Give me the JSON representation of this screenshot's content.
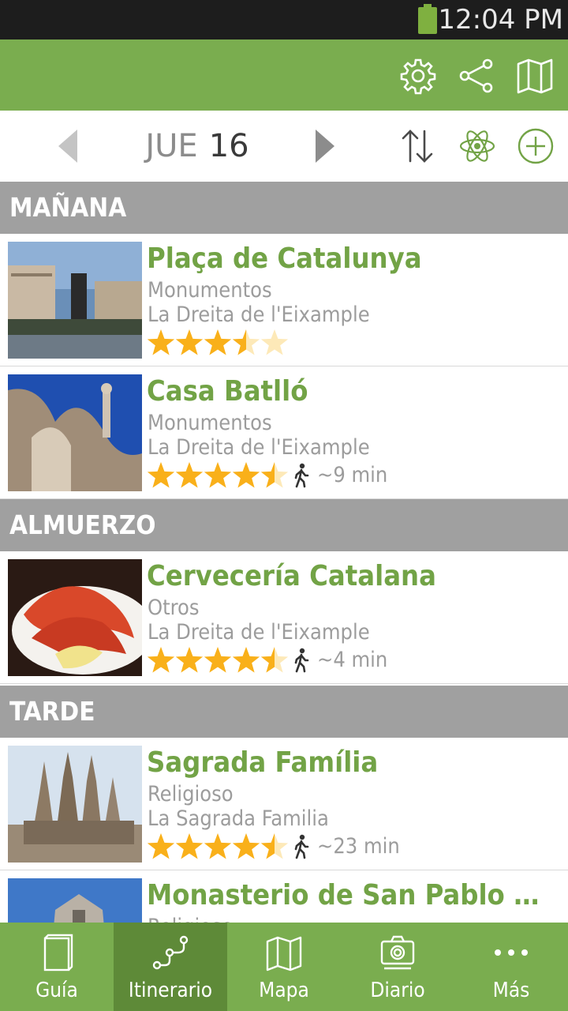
{
  "status_bar": {
    "time": "12:04 PM",
    "battery_color": "#7fb040"
  },
  "action_bar": {
    "color": "#7aad4f",
    "icons": [
      "gear-icon",
      "share-icon",
      "map-icon"
    ]
  },
  "date_nav": {
    "weekday": "JUE",
    "day": "16",
    "tools": [
      "sort-icon",
      "atom-icon",
      "add-icon"
    ]
  },
  "sections": [
    {
      "title": "MAÑANA",
      "items": [
        {
          "title": "Plaça de Catalunya",
          "category": "Monumentos",
          "area": "La Dreita de l'Eixample",
          "rating": 3.5,
          "walk_time": ""
        },
        {
          "title": "Casa Batlló",
          "category": "Monumentos",
          "area": "La Dreita de l'Eixample",
          "rating": 4.5,
          "walk_time": "~9 min"
        }
      ]
    },
    {
      "title": "ALMUERZO",
      "items": [
        {
          "title": "Cervecería Catalana",
          "category": "Otros",
          "area": "La Dreita de l'Eixample",
          "rating": 4.5,
          "walk_time": "~4 min"
        }
      ]
    },
    {
      "title": "TARDE",
      "items": [
        {
          "title": "Sagrada Família",
          "category": "Religioso",
          "area": "La Sagrada Familia",
          "rating": 4.5,
          "walk_time": "~23 min"
        },
        {
          "title": "Monasterio de San Pablo del...",
          "category": "Religioso",
          "area": "",
          "rating": 0,
          "walk_time": ""
        }
      ]
    }
  ],
  "bottom_nav": {
    "active_index": 1,
    "items": [
      {
        "label": "Guía",
        "icon": "book-icon"
      },
      {
        "label": "Itinerario",
        "icon": "route-icon"
      },
      {
        "label": "Mapa",
        "icon": "map-icon"
      },
      {
        "label": "Diario",
        "icon": "camera-icon"
      },
      {
        "label": "Más",
        "icon": "more-icon"
      }
    ]
  }
}
